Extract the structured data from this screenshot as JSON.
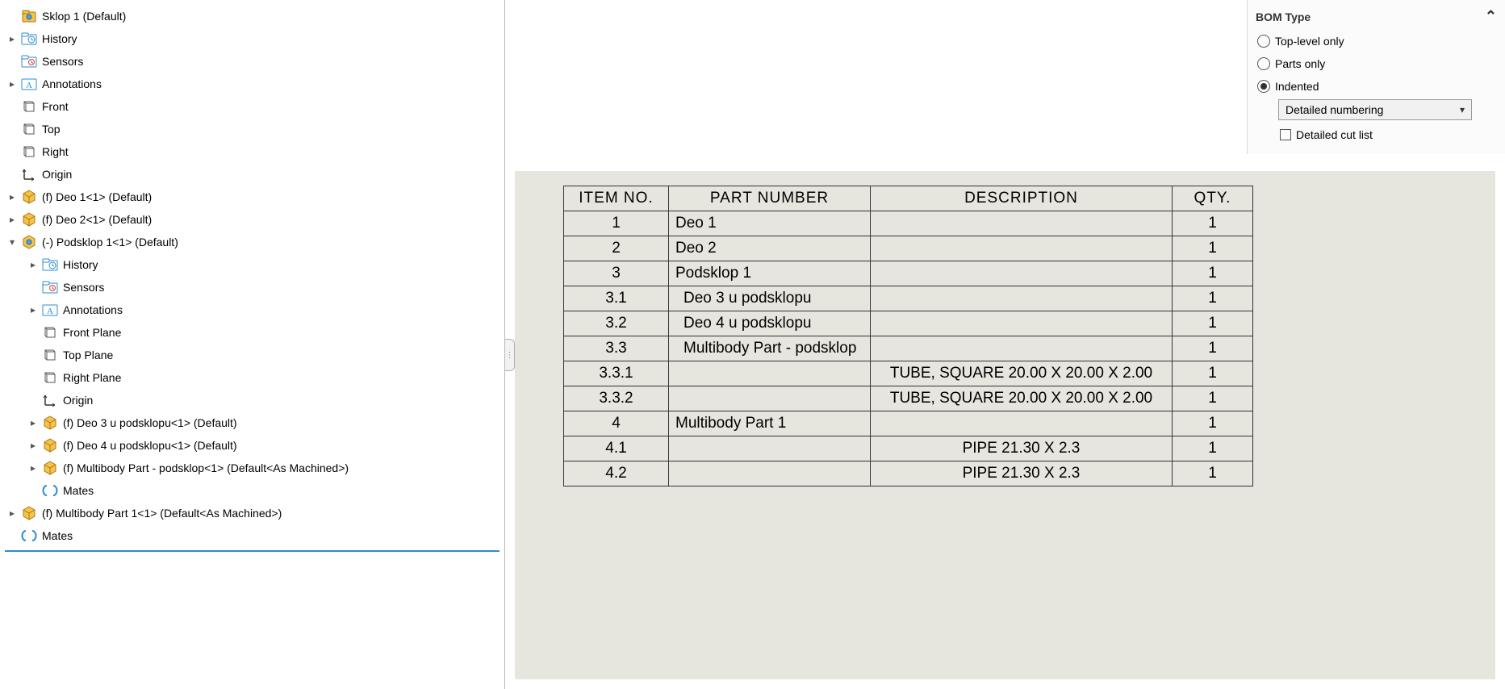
{
  "tree": {
    "root": "Sklop 1  (Default)",
    "items": [
      {
        "indent": 0,
        "exp": "▸",
        "icon": "folder-history",
        "label": "History"
      },
      {
        "indent": 0,
        "exp": "",
        "icon": "folder-sensors",
        "label": "Sensors"
      },
      {
        "indent": 0,
        "exp": "▸",
        "icon": "folder-annot",
        "label": "Annotations"
      },
      {
        "indent": 0,
        "exp": "",
        "icon": "plane",
        "label": "Front"
      },
      {
        "indent": 0,
        "exp": "",
        "icon": "plane",
        "label": "Top"
      },
      {
        "indent": 0,
        "exp": "",
        "icon": "plane",
        "label": "Right"
      },
      {
        "indent": 0,
        "exp": "",
        "icon": "origin",
        "label": "Origin"
      },
      {
        "indent": 0,
        "exp": "▸",
        "icon": "part",
        "label": "(f) Deo 1<1> (Default)"
      },
      {
        "indent": 0,
        "exp": "▸",
        "icon": "part",
        "label": "(f) Deo 2<1> (Default)"
      },
      {
        "indent": 0,
        "exp": "▾",
        "icon": "assembly",
        "label": "(-) Podsklop 1<1> (Default)"
      },
      {
        "indent": 1,
        "exp": "▸",
        "icon": "folder-history",
        "label": "History"
      },
      {
        "indent": 1,
        "exp": "",
        "icon": "folder-sensors",
        "label": "Sensors"
      },
      {
        "indent": 1,
        "exp": "▸",
        "icon": "folder-annot",
        "label": "Annotations"
      },
      {
        "indent": 1,
        "exp": "",
        "icon": "plane",
        "label": "Front Plane"
      },
      {
        "indent": 1,
        "exp": "",
        "icon": "plane",
        "label": "Top Plane"
      },
      {
        "indent": 1,
        "exp": "",
        "icon": "plane",
        "label": "Right Plane"
      },
      {
        "indent": 1,
        "exp": "",
        "icon": "origin",
        "label": "Origin"
      },
      {
        "indent": 1,
        "exp": "▸",
        "icon": "part",
        "label": "(f) Deo 3 u podsklopu<1> (Default)"
      },
      {
        "indent": 1,
        "exp": "▸",
        "icon": "part",
        "label": "(f) Deo 4 u podsklopu<1> (Default)"
      },
      {
        "indent": 1,
        "exp": "▸",
        "icon": "part",
        "label": "(f) Multibody Part - podsklop<1> (Default<As Machined>)"
      },
      {
        "indent": 1,
        "exp": "",
        "icon": "mates",
        "label": "Mates"
      },
      {
        "indent": 0,
        "exp": "▸",
        "icon": "part",
        "label": "(f) Multibody Part 1<1> (Default<As Machined>)"
      },
      {
        "indent": 0,
        "exp": "",
        "icon": "mates",
        "label": "Mates"
      }
    ]
  },
  "propPanel": {
    "title": "BOM Type",
    "options": {
      "topLevel": "Top-level only",
      "partsOnly": "Parts only",
      "indented": "Indented"
    },
    "selected": "indented",
    "dropdown": "Detailed numbering",
    "detailedCutList": "Detailed cut list"
  },
  "bom": {
    "headers": {
      "item": "ITEM NO.",
      "part": "PART NUMBER",
      "desc": "DESCRIPTION",
      "qty": "QTY."
    },
    "rows": [
      {
        "item": "1",
        "part": "Deo 1",
        "desc": "",
        "qty": "1",
        "pin": 0
      },
      {
        "item": "2",
        "part": "Deo 2",
        "desc": "",
        "qty": "1",
        "pin": 0
      },
      {
        "item": "3",
        "part": "Podsklop 1",
        "desc": "",
        "qty": "1",
        "pin": 0
      },
      {
        "item": "3.1",
        "part": "Deo 3 u podsklopu",
        "desc": "",
        "qty": "1",
        "pin": 1
      },
      {
        "item": "3.2",
        "part": "Deo 4 u podsklopu",
        "desc": "",
        "qty": "1",
        "pin": 1
      },
      {
        "item": "3.3",
        "part": "Multibody Part - podsklop",
        "desc": "",
        "qty": "1",
        "pin": 1
      },
      {
        "item": "3.3.1",
        "part": "",
        "desc": "TUBE, SQUARE 20.00 X 20.00 X 2.00",
        "qty": "1",
        "pin": 0
      },
      {
        "item": "3.3.2",
        "part": "",
        "desc": "TUBE, SQUARE 20.00 X 20.00 X 2.00",
        "qty": "1",
        "pin": 0
      },
      {
        "item": "4",
        "part": "Multibody Part 1",
        "desc": "",
        "qty": "1",
        "pin": 0
      },
      {
        "item": "4.1",
        "part": "",
        "desc": "PIPE 21.30 X 2.3",
        "qty": "1",
        "pin": 0
      },
      {
        "item": "4.2",
        "part": "",
        "desc": "PIPE 21.30 X 2.3",
        "qty": "1",
        "pin": 0
      }
    ]
  }
}
